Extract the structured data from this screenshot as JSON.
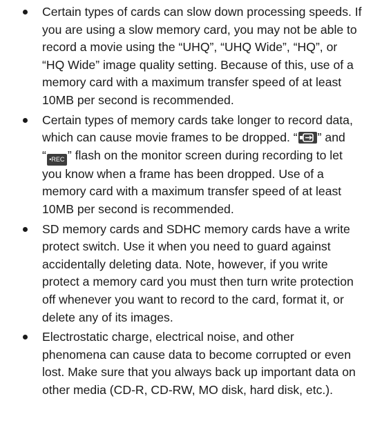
{
  "notes": [
    {
      "lines": [
        "Certain types of cards can slow down processing speeds. If",
        "you are using a slow memory card, you may not be able to",
        "record a movie using the “UHQ”, “UHQ Wide”, “HQ”, or",
        "“HQ Wide” image quality setting. Because of this, use of a",
        "memory card with a maximum transfer speed of at least",
        "10MB per second is recommended."
      ]
    },
    {
      "lines_a": [
        "Certain types of memory cards take longer to record data,"
      ],
      "line_icons_pre": "which can cause movie frames to be dropped. “",
      "line_icons_mid": "” and",
      "line_icons2_pre": "“",
      "line_icons2_post": "” flash on the monitor screen during recording to let",
      "icons": {
        "frame_drop": "frame-drop-icon",
        "rec": "•REC"
      },
      "lines_b": [
        "you know when a frame has been dropped. Use of a",
        "memory card with a maximum transfer speed of at least",
        "10MB per second is recommended."
      ]
    },
    {
      "lines": [
        "SD memory cards and SDHC memory cards have a write",
        "protect switch. Use it when you need to guard against",
        "accidentally deleting data. Note, however, if you write",
        "protect a memory card you must then turn write protection",
        "off whenever you want to record to the card, format it, or",
        "delete any of its images."
      ]
    },
    {
      "lines": [
        "Electrostatic charge, electrical noise, and other",
        "phenomena can cause data to become corrupted or even",
        "lost. Make sure that you always back up important data on",
        "other media (CD-R, CD-RW, MO disk, hard disk, etc.)."
      ]
    }
  ]
}
